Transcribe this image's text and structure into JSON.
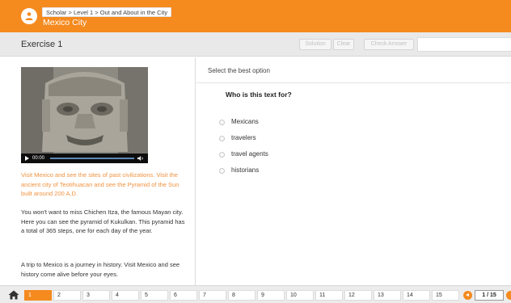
{
  "header": {
    "breadcrumb": "Scholar > Level 1 > Out and About in the City",
    "title": "Mexico City",
    "logo_icon": "user-badge-icon",
    "color": "#f58a1f"
  },
  "exercise_bar": {
    "title": "Exercise 1",
    "solution_label": "Solution",
    "clear_label": "Clear",
    "check_label": "Check Answer"
  },
  "video": {
    "time": "00:00",
    "icons": [
      "play-icon",
      "volume-icon"
    ]
  },
  "reading": {
    "highlight": "Visit Mexico and see the sites of past civilizations. Visit the ancient city of Teotihuacan and see the Pyramid of the Sun built around 200 A.D.",
    "paragraph1": "You won't want to miss Chichen Itza, the famous Mayan city. Here you can see the pyramid of Kukulkan. This pyramid has a total of 365 steps, one for each day of the year.",
    "paragraph2": "A trip to Mexico is a journey in history. Visit Mexico and see history come alive before your eyes."
  },
  "question": {
    "instruction": "Select the best option",
    "text": "Who is this text for?",
    "options": [
      "Mexicans",
      "travelers",
      "travel agents",
      "historians"
    ]
  },
  "pagination": {
    "pages": [
      "1",
      "2",
      "3",
      "4",
      "5",
      "6",
      "7",
      "8",
      "9",
      "10",
      "11",
      "12",
      "13",
      "14",
      "15"
    ],
    "current": 1,
    "counter": "1 / 15",
    "accent": "#f58a1f"
  }
}
